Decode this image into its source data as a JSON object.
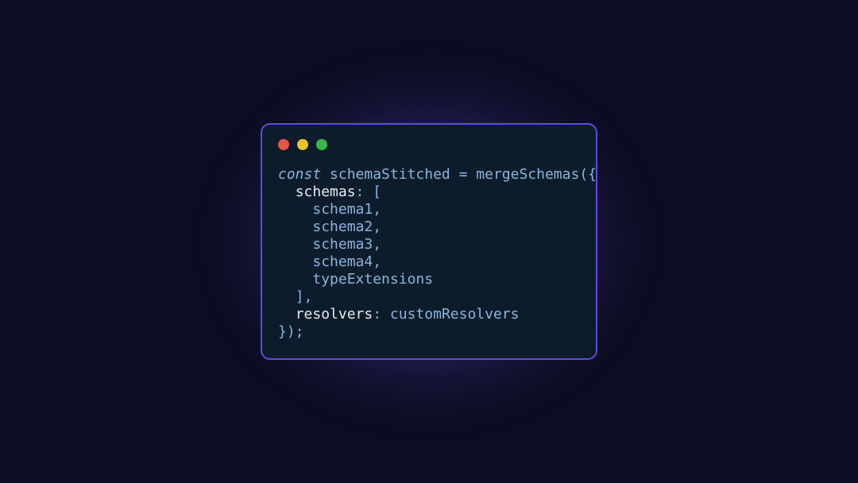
{
  "code": {
    "const": "const",
    "varName": "schemaStitched",
    "equals": " = ",
    "funcName": "mergeSchemas",
    "openParen": "({",
    "schemasKey": "schemas",
    "colon1": ": ",
    "openBracket": "[",
    "schema1": "schema1",
    "schema2": "schema2",
    "schema3": "schema3",
    "schema4": "schema4",
    "typeExt": "typeExtensions",
    "closeBracket": "],",
    "resolversKey": "resolvers",
    "colon2": ": ",
    "resolversVal": "customResolvers",
    "closeParen": "});",
    "comma": ","
  }
}
